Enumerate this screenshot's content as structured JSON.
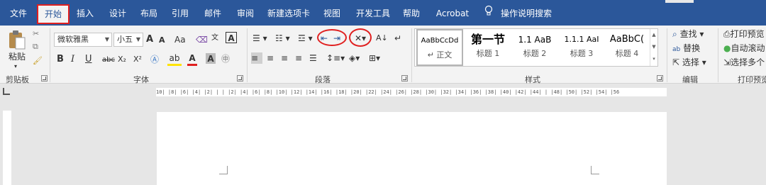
{
  "tabs": [
    {
      "label": "文件"
    },
    {
      "label": "开始"
    },
    {
      "label": "插入"
    },
    {
      "label": "设计"
    },
    {
      "label": "布局"
    },
    {
      "label": "引用"
    },
    {
      "label": "邮件"
    },
    {
      "label": "审阅"
    },
    {
      "label": "新建选项卡"
    },
    {
      "label": "视图"
    },
    {
      "label": "开发工具"
    },
    {
      "label": "帮助"
    },
    {
      "label": "Acrobat"
    }
  ],
  "tell_me": "操作说明搜索",
  "clipboard": {
    "paste_label": "粘贴",
    "group_label": "剪贴板"
  },
  "font": {
    "name": "微软雅黑",
    "size": "小五",
    "group_label": "字体",
    "aa_label": "Aa",
    "bold": "B",
    "italic": "I",
    "underline": "U",
    "strike": "abc",
    "sub": "X₂",
    "sup": "X²",
    "grow": "A",
    "shrink": "A"
  },
  "paragraph": {
    "group_label": "段落"
  },
  "styles": {
    "group_label": "样式",
    "items": [
      {
        "preview": "AaBbCcDd",
        "name": "↵ 正文"
      },
      {
        "preview": "第一节",
        "name": "标题 1"
      },
      {
        "preview": "1.1 AaB",
        "name": "标题 2"
      },
      {
        "preview": "1.1.1 AaI",
        "name": "标题 3"
      },
      {
        "preview": "AaBbC(",
        "name": "标题 4"
      }
    ]
  },
  "editing": {
    "group_label": "编辑",
    "find": "查找",
    "replace": "替换",
    "select": "选择"
  },
  "print": {
    "group_label": "打印预览",
    "preview": "打印预览",
    "auto_scroll": "自动滚动",
    "select_multi": "选择多个"
  },
  "ruler": {
    "ticks": "10| |8| |6| |4| |2| | | |2| |4| |6| |8| |10| |12| |14| |16| |18| |20| |22| |24| |26| |28| |30| |32| |34| |36| |38| |40| |42| |44| | |48| |50| |52| |54| |56"
  },
  "colors": {
    "brand": "#2b579a",
    "highlight": "#e02020"
  }
}
